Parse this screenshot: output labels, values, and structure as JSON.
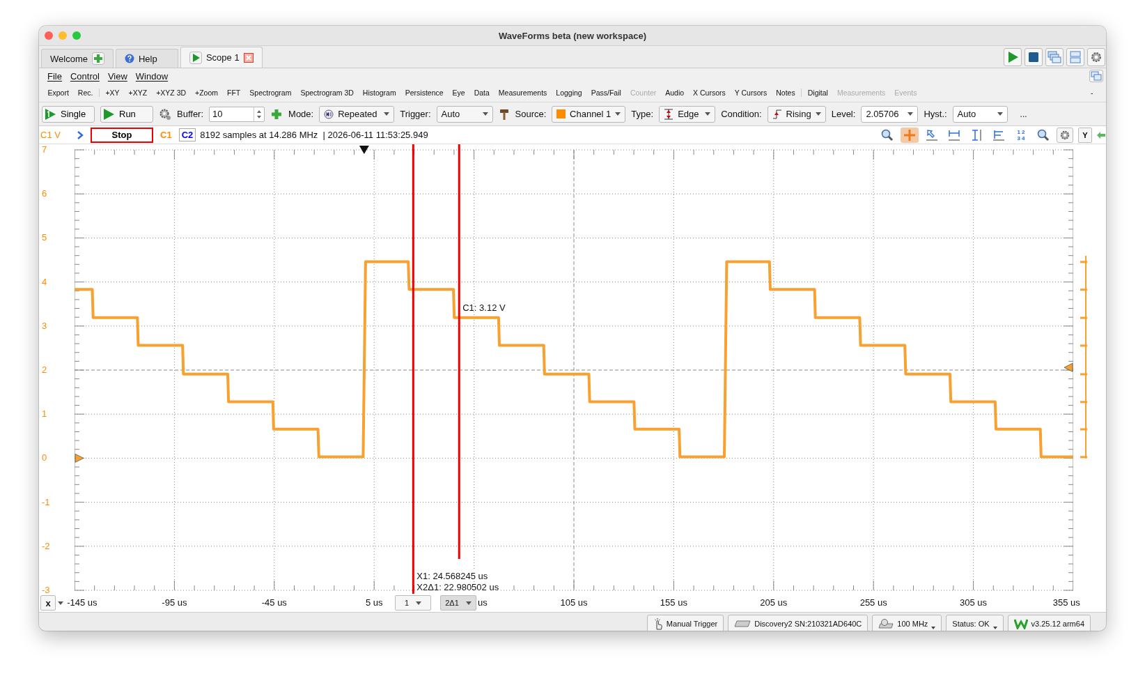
{
  "window": {
    "title": "WaveForms beta (new workspace)"
  },
  "tabs": [
    {
      "label": "Welcome",
      "kind": "welcome",
      "selected": false
    },
    {
      "label": "Help",
      "kind": "help",
      "selected": false
    },
    {
      "label": "Scope 1",
      "kind": "scope",
      "selected": true
    }
  ],
  "menu": [
    "File",
    "Control",
    "View",
    "Window"
  ],
  "instruments": [
    {
      "label": "Export",
      "disabled": false,
      "separator_after": false
    },
    {
      "label": "Rec.",
      "disabled": false,
      "separator_after": true
    },
    {
      "label": "+XY",
      "disabled": false,
      "separator_after": false
    },
    {
      "label": "+XYZ",
      "disabled": false,
      "separator_after": false
    },
    {
      "label": "+XYZ 3D",
      "disabled": false,
      "separator_after": false
    },
    {
      "label": "+Zoom",
      "disabled": false,
      "separator_after": false
    },
    {
      "label": "FFT",
      "disabled": false,
      "separator_after": false
    },
    {
      "label": "Spectrogram",
      "disabled": false,
      "separator_after": false
    },
    {
      "label": "Spectrogram 3D",
      "disabled": false,
      "separator_after": false
    },
    {
      "label": "Histogram",
      "disabled": false,
      "separator_after": false
    },
    {
      "label": "Persistence",
      "disabled": false,
      "separator_after": false
    },
    {
      "label": "Eye",
      "disabled": false,
      "separator_after": false
    },
    {
      "label": "Data",
      "disabled": false,
      "separator_after": false
    },
    {
      "label": "Measurements",
      "disabled": false,
      "separator_after": false
    },
    {
      "label": "Logging",
      "disabled": false,
      "separator_after": false
    },
    {
      "label": "Pass/Fail",
      "disabled": false,
      "separator_after": false
    },
    {
      "label": "Counter",
      "disabled": true,
      "separator_after": false
    },
    {
      "label": "Audio",
      "disabled": false,
      "separator_after": false
    },
    {
      "label": "X Cursors",
      "disabled": false,
      "separator_after": false
    },
    {
      "label": "Y Cursors",
      "disabled": false,
      "separator_after": false
    },
    {
      "label": "Notes",
      "disabled": false,
      "separator_after": true
    },
    {
      "label": "Digital",
      "disabled": false,
      "separator_after": false
    },
    {
      "label": "Measurements",
      "disabled": true,
      "separator_after": false
    },
    {
      "label": "Events",
      "disabled": true,
      "separator_after": false
    }
  ],
  "instruments_collapse": "-",
  "run_controls": {
    "single": "Single",
    "run": "Run",
    "buffer_label": "Buffer:",
    "buffer_value": "10",
    "mode_label": "Mode:",
    "mode": "Repeated",
    "trigger_label": "Trigger:",
    "trigger": "Auto",
    "source_label": "Source:",
    "source": "Channel 1",
    "type_label": "Type:",
    "type": "Edge",
    "condition_label": "Condition:",
    "condition": "Rising",
    "level_label": "Level:",
    "level_value": "2.05706",
    "hyst_label": "Hyst.:",
    "hyst": "Auto",
    "more": "..."
  },
  "info_bar": {
    "axis_unit": "C1 V",
    "stop": "Stop",
    "channels": [
      {
        "label": "C1",
        "selected": false,
        "color": "#ff8c00"
      },
      {
        "label": "C2",
        "selected": true,
        "color": "#0000ff"
      }
    ],
    "acquisition": "8192 samples at 14.286 MHz  | 2026-06-11 11:53:25.949",
    "tools": [
      {
        "kind": "zoom-reset",
        "selected": false
      },
      {
        "kind": "crosshair",
        "selected": true
      },
      {
        "kind": "pointer",
        "selected": false
      },
      {
        "kind": "measure-h",
        "selected": false
      },
      {
        "kind": "measure-v",
        "selected": false
      },
      {
        "kind": "levels",
        "selected": false
      },
      {
        "kind": "numbers",
        "selected": false,
        "top": "1 2",
        "bottom": "3 4"
      },
      {
        "kind": "zoom-fit",
        "selected": false
      }
    ],
    "y_button": "Y"
  },
  "plot": {
    "y_ticks": [
      "7",
      "6",
      "5",
      "4",
      "3",
      "2",
      "1",
      "0",
      "-1",
      "-2",
      "-3"
    ],
    "x_ticks": [
      {
        "label": "-145 us",
        "clipped": false
      },
      {
        "label": "-95 us",
        "clipped": false
      },
      {
        "label": "-45 us",
        "clipped": false
      },
      {
        "label": "5 us",
        "clipped": false
      },
      {
        "label": "us",
        "clipped": true
      },
      {
        "label": "105 us",
        "clipped": false
      },
      {
        "label": "155 us",
        "clipped": false
      },
      {
        "label": "205 us",
        "clipped": false
      },
      {
        "label": "255 us",
        "clipped": false
      },
      {
        "label": "305 us",
        "clipped": false
      },
      {
        "label": "355 us",
        "clipped": false
      }
    ],
    "cursor_labels": [
      "X1: 24.568245 us",
      "X2Δ1: 22.980502 us"
    ],
    "value_label": "C1: 3.12 V",
    "x_button": "x",
    "cursor_select": "1",
    "delta_select": "2Δ1"
  },
  "status_bar": [
    {
      "kind": "trigger",
      "label": "Manual Trigger",
      "dropdown": false
    },
    {
      "kind": "device",
      "label": "Discovery2 SN:210321AD640C",
      "dropdown": false
    },
    {
      "kind": "clock",
      "label": "100 MHz",
      "dropdown": true
    },
    {
      "kind": "status",
      "label": "Status: OK",
      "dropdown": true
    },
    {
      "kind": "version",
      "label": "v3.25.12 arm64",
      "dropdown": false
    }
  ]
}
